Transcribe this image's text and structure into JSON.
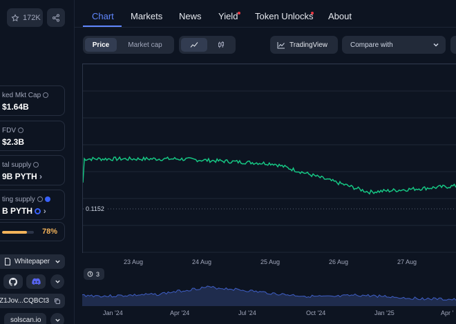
{
  "sidebar": {
    "star_count": "172K",
    "cards": [
      {
        "label": "ked Mkt Cap",
        "value": "$1.64B"
      },
      {
        "label": "FDV",
        "value": "$2.3B"
      },
      {
        "label": "tal supply",
        "value": "9B PYTH"
      },
      {
        "label": "ting supply",
        "value": "B PYTH"
      }
    ],
    "progress_pct": "78%",
    "progress_value": 0.78,
    "whitepaper": "Whitepaper",
    "contract": "Z1Jov...CQBCt3",
    "explorer": "solscan.io",
    "icons": [
      "star-icon",
      "share-icon",
      "github-icon",
      "discord-icon",
      "chevron-down-icon",
      "copy-icon",
      "document-icon"
    ]
  },
  "tabs": [
    {
      "label": "Chart",
      "active": true
    },
    {
      "label": "Markets"
    },
    {
      "label": "News"
    },
    {
      "label": "Yield"
    },
    {
      "label": "Token Unlocks"
    },
    {
      "label": "About"
    }
  ],
  "controls": {
    "price": "Price",
    "market_cap": "Market cap",
    "tradingview": "TradingView",
    "compare_placeholder": "Compare with"
  },
  "chart": {
    "current_price_label": "0.1152",
    "x_labels": [
      "23 Aug",
      "24 Aug",
      "25 Aug",
      "26 Aug",
      "27 Aug"
    ],
    "nav_badge": "3",
    "nav_labels": [
      "Jan '24",
      "Apr '24",
      "Jul '24",
      "Oct '24",
      "Jan '25",
      "Apr '"
    ],
    "colors": {
      "up": "#16c784",
      "down": "#ea3943",
      "accent": "#6188ff"
    }
  },
  "chart_data": {
    "type": "line",
    "x": [
      "23 Aug",
      "24 Aug",
      "25 Aug",
      "26 Aug",
      "27 Aug"
    ],
    "series": [
      {
        "values": [
          0.118,
          0.118,
          0.1175,
          0.1145,
          0.1152
        ]
      }
    ],
    "reference_price": 0.1152,
    "grid": true
  }
}
